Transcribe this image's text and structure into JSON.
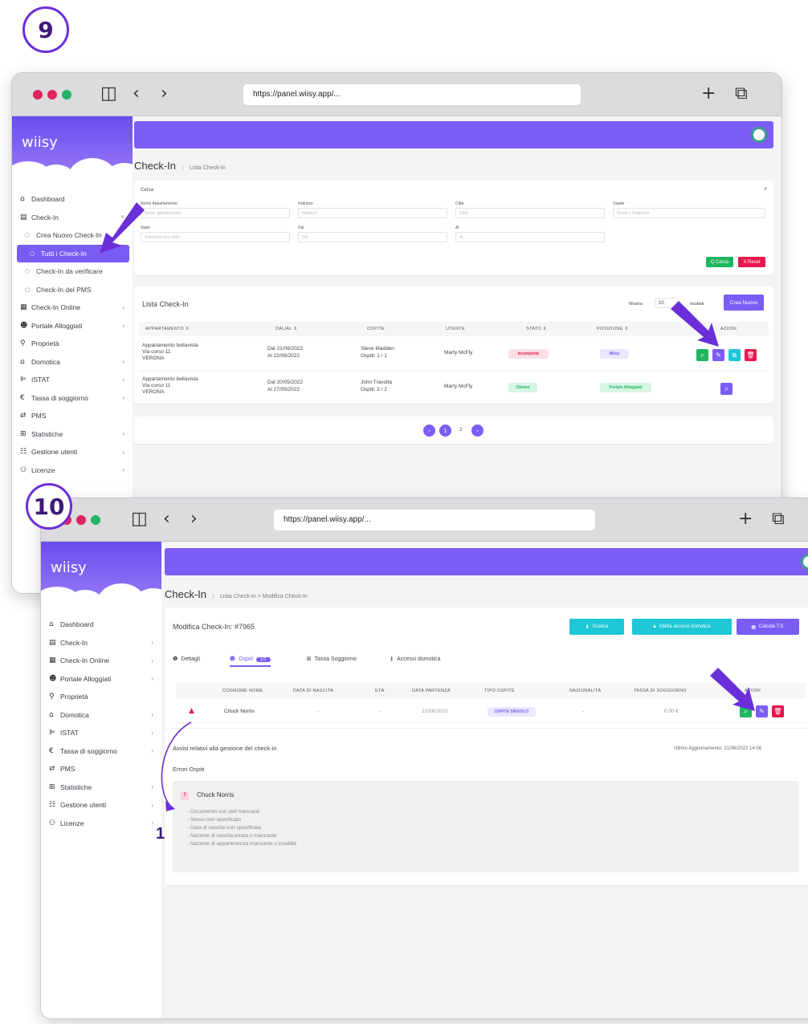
{
  "steps": {
    "first": "9",
    "second": "10",
    "annotation": "1"
  },
  "colors": {
    "accent": "#7b5cf5",
    "green": "#1fb561",
    "red": "#e8174d",
    "teal": "#1ec6d6"
  },
  "win1": {
    "url": "https://panel.wiisy.app/...",
    "logo": "wiisy",
    "menu": [
      {
        "icon": "home-icon",
        "label": "Dashboard"
      },
      {
        "icon": "checkin-icon",
        "label": "Check-In",
        "chev": "˅"
      },
      {
        "icon": "circle-icon",
        "label": "Crea Nuovo Check-In",
        "sub": true
      },
      {
        "icon": "circle-icon",
        "label": "Tutti i Check-In",
        "sub": true,
        "active": true
      },
      {
        "icon": "circle-icon",
        "label": "Check-In da verificare",
        "sub": true
      },
      {
        "icon": "circle-icon",
        "label": "Check-In del PMS",
        "sub": true
      },
      {
        "icon": "calendar-icon",
        "label": "Check-In Online",
        "chev": "›"
      },
      {
        "icon": "people-icon",
        "label": "Portale Alloggiati",
        "chev": "›"
      },
      {
        "icon": "pin-icon",
        "label": "Proprietà"
      },
      {
        "icon": "home-gear-icon",
        "label": "Domotica",
        "chev": "›"
      },
      {
        "icon": "chart-icon",
        "label": "ISTAT",
        "chev": "›"
      },
      {
        "icon": "euro-icon",
        "label": "Tassa di soggiorno",
        "chev": "›"
      },
      {
        "icon": "pms-icon",
        "label": "PMS"
      },
      {
        "icon": "table-icon",
        "label": "Statistiche",
        "chev": "›"
      },
      {
        "icon": "users-icon",
        "label": "Gestione utenti",
        "chev": "›"
      },
      {
        "icon": "license-icon",
        "label": "Licenze",
        "chev": "›"
      }
    ],
    "page_title": "Check-In",
    "breadcrumb": "Lista Check-In",
    "search": {
      "title": "Cerca",
      "fields": [
        {
          "label": "Nome Appartamento",
          "placeholder": "Nome appartamento"
        },
        {
          "label": "Indirizzo",
          "placeholder": "Indirizzo"
        },
        {
          "label": "Città",
          "placeholder": "Città"
        },
        {
          "label": "Ospite",
          "placeholder": "Nome o Cognome"
        },
        {
          "label": "Stato",
          "placeholder": "Seleziona uno stato"
        },
        {
          "label": "Dal",
          "placeholder": "Dal"
        },
        {
          "label": "Al",
          "placeholder": "Al"
        }
      ],
      "search_btn": "Q Cerca",
      "reset_btn": "X Reset"
    },
    "list": {
      "title": "Lista Check-In",
      "show_label": "Mostra",
      "show_value": "10",
      "results_label": "risultati",
      "new_btn": "Crea Nuovo",
      "headers": [
        "APPARTAMENTO ⇕",
        "DAL/AL ⇕",
        "OSPITE",
        "UTENTE",
        "STATO ⇕",
        "POSIZIONE ⇕",
        "AZIONI"
      ],
      "rows": [
        {
          "apt": [
            "Appartamento bellavista",
            "Via corso 11",
            "VERONA"
          ],
          "dates": [
            "Dal 21/06/2022",
            "Al 22/06/2022"
          ],
          "guest": [
            "Steve Madden",
            "Ospiti: 1 / 1"
          ],
          "user": "Marty McFly",
          "status": "Incompleto",
          "position": "Wiisy"
        },
        {
          "apt": [
            "Appartamento bellavista",
            "Via corso 11",
            "VERONA"
          ],
          "dates": [
            "Dal 20/05/2022",
            "Al 27/05/2022"
          ],
          "guest": [
            "John Travolta",
            "Ospiti: 2 / 2"
          ],
          "user": "Marty McFly",
          "status": "Chiuso",
          "position": "Portale Alloggiati"
        }
      ]
    },
    "pagination": {
      "prev": "‹",
      "current": "1",
      "next_page": "2",
      "next": "›"
    }
  },
  "win2": {
    "url": "https://panel.wiisy.app/...",
    "logo": "wiisy",
    "menu": [
      {
        "icon": "home-icon",
        "label": "Dashboard"
      },
      {
        "icon": "checkin-icon",
        "label": "Check-In",
        "chev": "›"
      },
      {
        "icon": "calendar-icon",
        "label": "Check-In Online",
        "chev": "›"
      },
      {
        "icon": "people-icon",
        "label": "Portale Alloggiati",
        "chev": "›"
      },
      {
        "icon": "pin-icon",
        "label": "Proprietà"
      },
      {
        "icon": "home-gear-icon",
        "label": "Domotica",
        "chev": "›"
      },
      {
        "icon": "chart-icon",
        "label": "ISTAT",
        "chev": "›"
      },
      {
        "icon": "euro-icon",
        "label": "Tassa di soggiorno",
        "chev": "›"
      },
      {
        "icon": "pms-icon",
        "label": "PMS"
      },
      {
        "icon": "table-icon",
        "label": "Statistiche",
        "chev": "›"
      },
      {
        "icon": "users-icon",
        "label": "Gestione utenti",
        "chev": "›"
      },
      {
        "icon": "license-icon",
        "label": "Licenze",
        "chev": "›"
      }
    ],
    "page_title": "Check-In",
    "breadcrumb": "Lista Check-In > Modifica Check-In",
    "edit_title": "Modifica Check-In: #7965",
    "buttons": {
      "download": "Scarica",
      "unlock": "Abilita accessi domotica",
      "calc": "Calcola T.S."
    },
    "tabs": [
      {
        "label": "Dettagli",
        "icon": "info-icon"
      },
      {
        "label": "Ospiti",
        "icon": "people-icon",
        "badge": "1/1",
        "active": true
      },
      {
        "label": "Tassa Soggiorno",
        "icon": "table-icon"
      },
      {
        "label": "Accessi domotica",
        "icon": "key-icon"
      }
    ],
    "headers": [
      "COGNOME NOME",
      "DATA DI NASCITA",
      "ETÀ",
      "DATA PARTENZA",
      "TIPO OSPITE",
      "NAZIONALITÀ",
      "TASSA DI SOGGIORNO",
      "AZIONI"
    ],
    "row": {
      "name": "Chuck Norris",
      "birth": "-",
      "age": "-",
      "departure": "21/06/2022",
      "type": "OSPITE SINGOLO",
      "nationality": "-",
      "tax": "0.00 €"
    },
    "notice_title": "Avvisi relativi alla gestione del check-in",
    "last_update": "Ultimo Aggiornamento: 21/06/2022 14:06",
    "errors_title": "Errori Ospiti",
    "error_guest": "Chuck Norris",
    "errors": [
      "- Documento con dati mancanti",
      "- Sesso non specificato",
      "- Data di nascita non specificata",
      "- Nazione di nascita errata o mancante",
      "- Nazione di appartenenza mancante o invalida"
    ]
  }
}
